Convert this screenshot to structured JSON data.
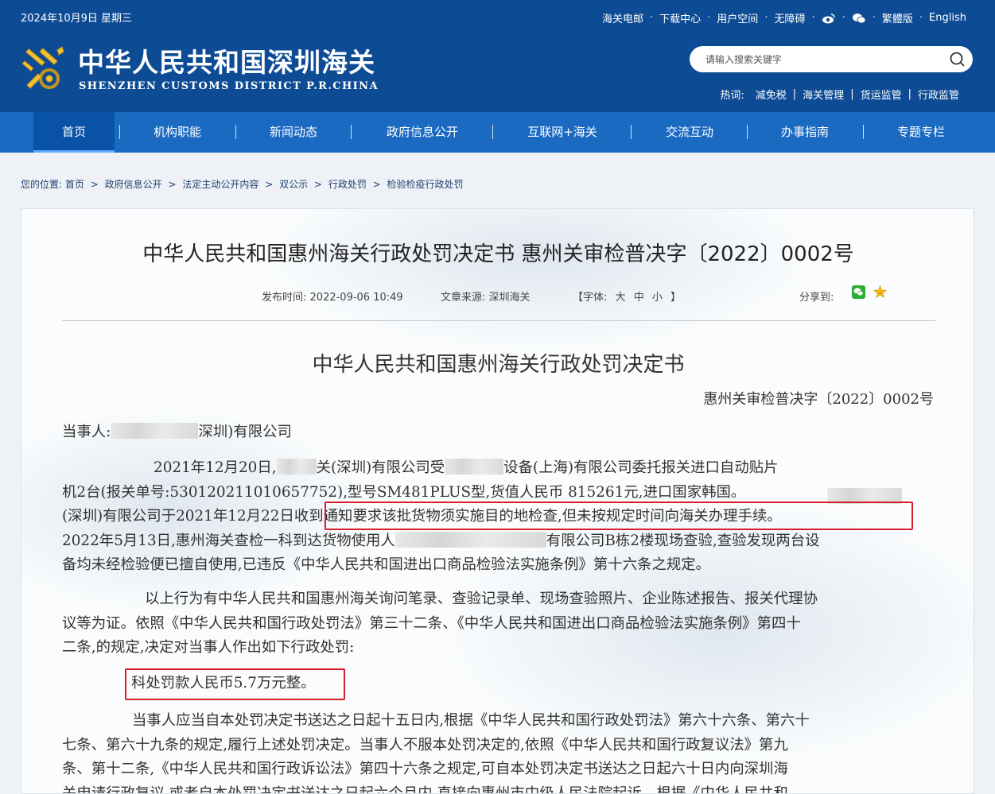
{
  "header": {
    "date": "2024年10月9日 星期三",
    "top_links": [
      "海关电邮",
      "下载中心",
      "用户空间",
      "无障碍"
    ],
    "weibo_icon": "weibo-icon",
    "wechat_icon": "wechat-icon",
    "traditional": "繁體版",
    "english": "English",
    "site_title": "中华人民共和国深圳海关",
    "site_subtitle": "SHENZHEN CUSTOMS DISTRICT P.R.CHINA",
    "search_placeholder": "请输入搜索关键字",
    "hot_label": "热词:",
    "hot_words": [
      "减免税",
      "海关管理",
      "货运监管",
      "行政监管"
    ]
  },
  "nav": {
    "items": [
      "首页",
      "机构职能",
      "新闻动态",
      "政府信息公开",
      "互联网+海关",
      "交流互动",
      "办事指南",
      "专题专栏"
    ]
  },
  "breadcrumb": {
    "prefix": "您的位置:",
    "items": [
      "首页",
      "政府信息公开",
      "法定主动公开内容",
      "双公示",
      "行政处罚",
      "检验检疫行政处罚"
    ]
  },
  "article": {
    "title": "中华人民共和国惠州海关行政处罚决定书 惠州关审检普决字〔2022〕0002号",
    "publish_label": "发布时间:",
    "publish_time": "2022-09-06 10:49",
    "source_label": "文章来源:",
    "source": "深圳海关",
    "font_open": "【字体:",
    "font_large": "大",
    "font_medium": "中",
    "font_small": "小",
    "font_close": "】",
    "share_label": "分享到:",
    "body_title": "中华人民共和国惠州海关行政处罚决定书",
    "doc_number": "惠州关审检普决字〔2022〕0002号",
    "party_label": "当事人:",
    "party_suffix": "深圳)有限公司",
    "p1": {
      "l1a": "2021年12月20日,",
      "l1b": "关(深圳)有限公司受",
      "l1c": "设备(上海)有限公司委托报关进口自动贴片",
      "l2": "机2台(报关单号:530120211010657752),型号SM481PLUS型,货值人民币 815261元,进口国家韩国。",
      "l3a": "(深圳)有限公司于2021年12月22日",
      "l3b": "收到通知要求该批货物须实施目的地检查,但未按规定时间向海关办理手续。",
      "l4a": "2022年5月13日,惠州海关查检一科到达货物使用人",
      "l4b": "有限公司B栋2楼现场查验,查验发现两台设",
      "l5": "备均未经检验便已擅自使用,已违反《中华人民共和国进出口商品检验法实施条例》第十六条之规定。"
    },
    "p2": {
      "l1": "以上行为有中华人民共和国惠州海关询问笔录、查验记录单、现场查验照片、企业陈述报告、报关代理协",
      "l2": "议等为证。依照《中华人民共和国行政处罚法》第三十二条、《中华人民共和国进出口商品检验法实施条例》第四十",
      "l3": "二条,的规定,决定对当事人作出如下行政处罚:"
    },
    "penalty": "科处罚款人民币5.7万元整。",
    "p3": {
      "l1": "当事人应当自本处罚决定书送达之日起十五日内,根据《中华人民共和国行政处罚法》第六十六条、第六十",
      "l2": "七条、第六十九条的规定,履行上述处罚决定。当事人不服本处罚决定的,依照《中华人民共和国行政复议法》第九",
      "l3": "条、第十二条,《中华人民共和国行政诉讼法》第四十六条之规定,可自本处罚决定书送达之日起六十日内向深圳海",
      "l4": "关申请行政复议,或者自本处罚决定书送达之日起六个月内,直接向惠州市中级人民法院起诉。根据《中华人民共和"
    }
  },
  "colors": {
    "header_bg": "#0d4c95",
    "nav_bg": "#1b6ac2",
    "highlight": "#d81e2a"
  }
}
